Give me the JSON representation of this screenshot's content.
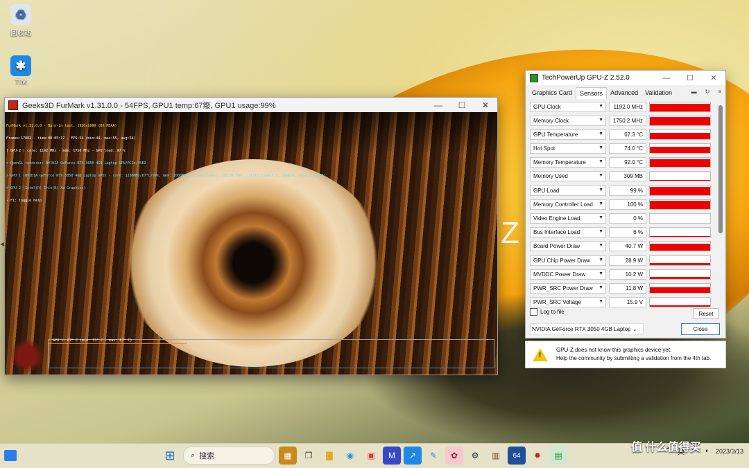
{
  "desktop": {
    "icons": [
      {
        "label": "回收站"
      },
      {
        "label": "TIM"
      }
    ],
    "big_text": "Z",
    "watermark": "值 什么值得买"
  },
  "furmark": {
    "title": "Geeks3D FurMark v1.31.0.0 - 54FPS, GPU1 temp:67癈, GPU1 usage:99%",
    "osd_lines": [
      {
        "text": "FurMark v1.31.0.0 - Burn-in test, 1920x1080 (0X MSAA)",
        "color": "y"
      },
      {
        "text": "Frames:17882 - time:00:05:17 - FPS:54 (min:44, max:55, avg:54)",
        "color": "w"
      },
      {
        "text": "[ GPU-Z ] core: 1192 MHz - mem: 1750 MHz - GPU load: 97 %",
        "color": "w"
      },
      {
        "text": "> OpenGL renderer: NVIDIA GeForce RTX 3050 4GB Laptop GPU/PCIe/SSE2",
        "color": "c"
      },
      {
        "text": "> GPU 1 (NVIDIA GeForce RTX 3050 4GB Laptop GPU) - core: 1200MHz/67°C/99%, mem: 2000MHz/7%, GPU power: 115.9% TDP, limits:[power:1, temp:0, volt:0, OV:0]",
        "color": "c"
      },
      {
        "text": "> GPU 2 (Intel(R) Iris(R) Xe Graphics)",
        "color": "c"
      },
      {
        "text": "- F1: toggle help",
        "color": "w"
      }
    ],
    "graph_label": "GPU 1: 67° C (min: 53° C - max: 67° C)"
  },
  "gpuz": {
    "title": "TechPowerUp GPU-Z 2.52.0",
    "tabs": [
      "Graphics Card",
      "Sensors",
      "Advanced",
      "Validation"
    ],
    "active_tab": "Sensors",
    "sensors": [
      {
        "name": "GPU Clock",
        "value": "1192.0 MHz",
        "level": 0.85
      },
      {
        "name": "Memory Clock",
        "value": "1750.2 MHz",
        "level": 0.95
      },
      {
        "name": "GPU Temperature",
        "value": "67.3 °C",
        "level": 0.7
      },
      {
        "name": "Hot Spot",
        "value": "74.0 °C",
        "level": 0.7
      },
      {
        "name": "Memory Temperature",
        "value": "92.0 °C",
        "level": 0.85
      },
      {
        "name": "Memory Used",
        "value": "309 MB",
        "level": 0.08
      },
      {
        "name": "GPU Load",
        "value": "99 %",
        "level": 0.95
      },
      {
        "name": "Memory Controller Load",
        "value": "100 %",
        "level": 0.95
      },
      {
        "name": "Video Engine Load",
        "value": "0 %",
        "level": 0
      },
      {
        "name": "Bus Interface Load",
        "value": "6 %",
        "level": 0.06
      },
      {
        "name": "Board Power Draw",
        "value": "40.7 W",
        "level": 0.8
      },
      {
        "name": "GPU Chip Power Draw",
        "value": "28.9 W",
        "level": 0.2
      },
      {
        "name": "MVDDC Power Draw",
        "value": "10.2 W",
        "level": 0.25
      },
      {
        "name": "PWR_SRC Power Draw",
        "value": "11.8 W",
        "level": 0.6
      },
      {
        "name": "PWR_SRC Voltage",
        "value": "15.9 V",
        "level": 0.15
      }
    ],
    "log_to_file": "Log to file",
    "reset": "Reset",
    "gpu_select": "NVIDIA GeForce RTX 3050 4GB Laptop GPU",
    "close": "Close",
    "warning_line1": "GPU-Z does not know this graphics device yet.",
    "warning_line2": "Help the community by submitting a validation from the 4th tab."
  },
  "taskbar": {
    "search_placeholder": "搜索",
    "ime": "英",
    "time": "",
    "date": "2023/3/13"
  },
  "colors": {
    "bar_fill": "#ee0000",
    "accent": "#2b7bd6"
  }
}
